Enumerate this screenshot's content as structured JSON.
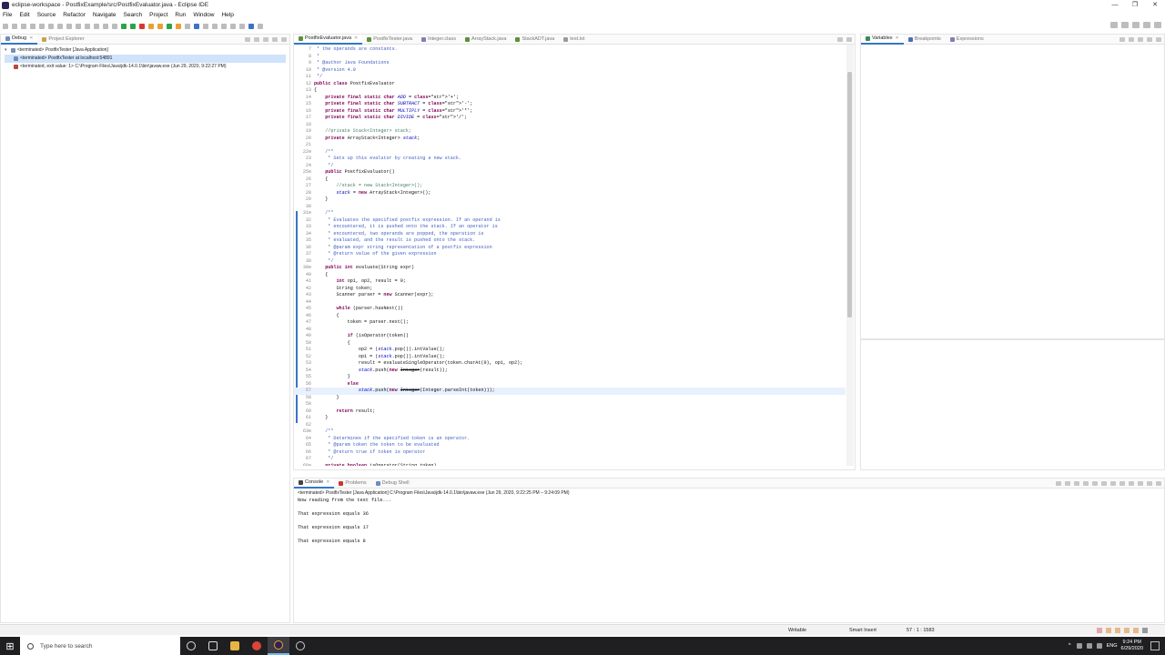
{
  "window": {
    "title": "eclipse-workspace - PostfixExample/src/PostfixEvaluator.java - Eclipse IDE",
    "controls": [
      "—",
      "❐",
      "✕"
    ]
  },
  "menu": [
    "File",
    "Edit",
    "Source",
    "Refactor",
    "Navigate",
    "Search",
    "Project",
    "Run",
    "Window",
    "Help"
  ],
  "left_panel": {
    "tabs": [
      {
        "label": "Debug",
        "active": true
      },
      {
        "label": "Project Explorer",
        "active": false
      }
    ],
    "tree": [
      {
        "label": "<terminated> PostfixTester [Java Application]",
        "selected": false
      },
      {
        "label": "<terminated> PostfixTester at localhost:54891",
        "selected": true
      },
      {
        "label": "<terminated, exit value: 1> C:\\Program Files\\Java\\jdk-14.0.1\\bin\\javaw.exe (Jun 29, 2020, 9:22:27 PM)",
        "selected": false
      }
    ]
  },
  "editor": {
    "tabs": [
      {
        "label": "PostfixEvaluator.java",
        "active": true
      },
      {
        "label": "PostfixTester.java",
        "active": false
      },
      {
        "label": "Integer.class",
        "active": false
      },
      {
        "label": "ArrayStack.java",
        "active": false
      },
      {
        "label": "StackADT.java",
        "active": false
      },
      {
        "label": "test.txt",
        "active": false
      }
    ],
    "current_line": 57,
    "lines": [
      {
        "n": "7",
        "c": " * the operands are constants."
      },
      {
        "n": "8",
        "c": " *"
      },
      {
        "n": "9",
        "c": " * @author Java Foundations"
      },
      {
        "n": "10",
        "c": " * @version 4.0"
      },
      {
        "n": "11",
        "c": " */"
      },
      {
        "n": "12",
        "c": "public class PostfixEvaluator"
      },
      {
        "n": "13",
        "c": "{"
      },
      {
        "n": "14",
        "c": "    private final static char ADD = '+';"
      },
      {
        "n": "15",
        "c": "    private final static char SUBTRACT = '-';"
      },
      {
        "n": "16",
        "c": "    private final static char MULTIPLY = '*';"
      },
      {
        "n": "17",
        "c": "    private final static char DIVIDE = '/';"
      },
      {
        "n": "18",
        "c": ""
      },
      {
        "n": "19",
        "c": "    //private Stack<Integer> stack;"
      },
      {
        "n": "20",
        "c": "    private ArrayStack<Integer> stack;"
      },
      {
        "n": "21",
        "c": ""
      },
      {
        "n": "22⊖",
        "c": "    /**"
      },
      {
        "n": "23",
        "c": "     * Sets up this evalutor by creating a new stack."
      },
      {
        "n": "24",
        "c": "     */"
      },
      {
        "n": "25⊖",
        "c": "    public PostfixEvaluator()"
      },
      {
        "n": "26",
        "c": "    {"
      },
      {
        "n": "27",
        "c": "        //stack = new Stack<Integer>();"
      },
      {
        "n": "28",
        "c": "        stack = new ArrayStack<Integer>();"
      },
      {
        "n": "29",
        "c": "    }"
      },
      {
        "n": "30",
        "c": ""
      },
      {
        "n": "31⊖",
        "c": "    /**"
      },
      {
        "n": "32",
        "c": "     * Evaluates the specified postfix expression. If an operand is"
      },
      {
        "n": "33",
        "c": "     * encountered, it is pushed onto the stack. If an operator is"
      },
      {
        "n": "34",
        "c": "     * encountered, two operands are popped, the operation is"
      },
      {
        "n": "35",
        "c": "     * evaluated, and the result is pushed onto the stack."
      },
      {
        "n": "36",
        "c": "     * @param expr string representation of a postfix expression"
      },
      {
        "n": "37",
        "c": "     * @return value of the given expression"
      },
      {
        "n": "38",
        "c": "     */"
      },
      {
        "n": "39⊖",
        "c": "    public int evaluate(String expr)"
      },
      {
        "n": "40",
        "c": "    {"
      },
      {
        "n": "41",
        "c": "        int op1, op2, result = 0;"
      },
      {
        "n": "42",
        "c": "        String token;"
      },
      {
        "n": "43",
        "c": "        Scanner parser = new Scanner(expr);"
      },
      {
        "n": "44",
        "c": ""
      },
      {
        "n": "45",
        "c": "        while (parser.hasNext())"
      },
      {
        "n": "46",
        "c": "        {"
      },
      {
        "n": "47",
        "c": "            token = parser.next();"
      },
      {
        "n": "48",
        "c": ""
      },
      {
        "n": "49",
        "c": "            if (isOperator(token))"
      },
      {
        "n": "50",
        "c": "            {"
      },
      {
        "n": "51",
        "c": "                op2 = (stack.pop()).intValue();"
      },
      {
        "n": "52",
        "c": "                op1 = (stack.pop()).intValue();"
      },
      {
        "n": "53",
        "c": "                result = evaluateSingleOperator(token.charAt(0), op1, op2);"
      },
      {
        "n": "54",
        "c": "                stack.push(new Integer(result));"
      },
      {
        "n": "55",
        "c": "            }"
      },
      {
        "n": "56",
        "c": "            else"
      },
      {
        "n": "57",
        "c": "                stack.push(new Integer(Integer.parseInt(token)));"
      },
      {
        "n": "58",
        "c": "        }"
      },
      {
        "n": "59",
        "c": ""
      },
      {
        "n": "60",
        "c": "        return result;"
      },
      {
        "n": "61",
        "c": "    }"
      },
      {
        "n": "62",
        "c": ""
      },
      {
        "n": "63⊖",
        "c": "    /**"
      },
      {
        "n": "64",
        "c": "     * Determines if the specified token is an operator."
      },
      {
        "n": "65",
        "c": "     * @param token the token to be evaluated"
      },
      {
        "n": "66",
        "c": "     * @return true if token is operator"
      },
      {
        "n": "67",
        "c": "     */"
      },
      {
        "n": "68⊖",
        "c": "    private boolean isOperator(String token)"
      }
    ]
  },
  "right_panel": {
    "tabs": [
      {
        "label": "Variables",
        "active": true
      },
      {
        "label": "Breakpoints",
        "active": false
      },
      {
        "label": "Expressions",
        "active": false
      }
    ]
  },
  "console": {
    "tabs": [
      {
        "label": "Console",
        "active": true
      },
      {
        "label": "Problems",
        "active": false
      },
      {
        "label": "Debug Shell",
        "active": false
      }
    ],
    "terminated": "<terminated> PostfixTester [Java Application] C:\\Program Files\\Java\\jdk-14.0.1\\bin\\javaw.exe (Jun 29, 2020, 9:22:25 PM – 9:24:09 PM)",
    "output": [
      "Now reading from the test file...",
      "",
      "That expression equals 36",
      "",
      "That expression equals 17",
      "",
      "That expression equals 8"
    ]
  },
  "status": {
    "writable": "Writable",
    "insert": "Smart Insert",
    "position": "57 : 1 : 1583"
  },
  "taskbar": {
    "search_placeholder": "Type here to search",
    "lang": "ENG",
    "time": "9:24 PM",
    "date": "6/29/2020"
  },
  "colors": {
    "accent": "#3477c7",
    "keyword": "#7f0055",
    "comment": "#3f7f5f",
    "javadoc": "#3f5fbf",
    "string": "#2a00ff",
    "field": "#0000c0",
    "current_line": "#e8f2fe"
  }
}
